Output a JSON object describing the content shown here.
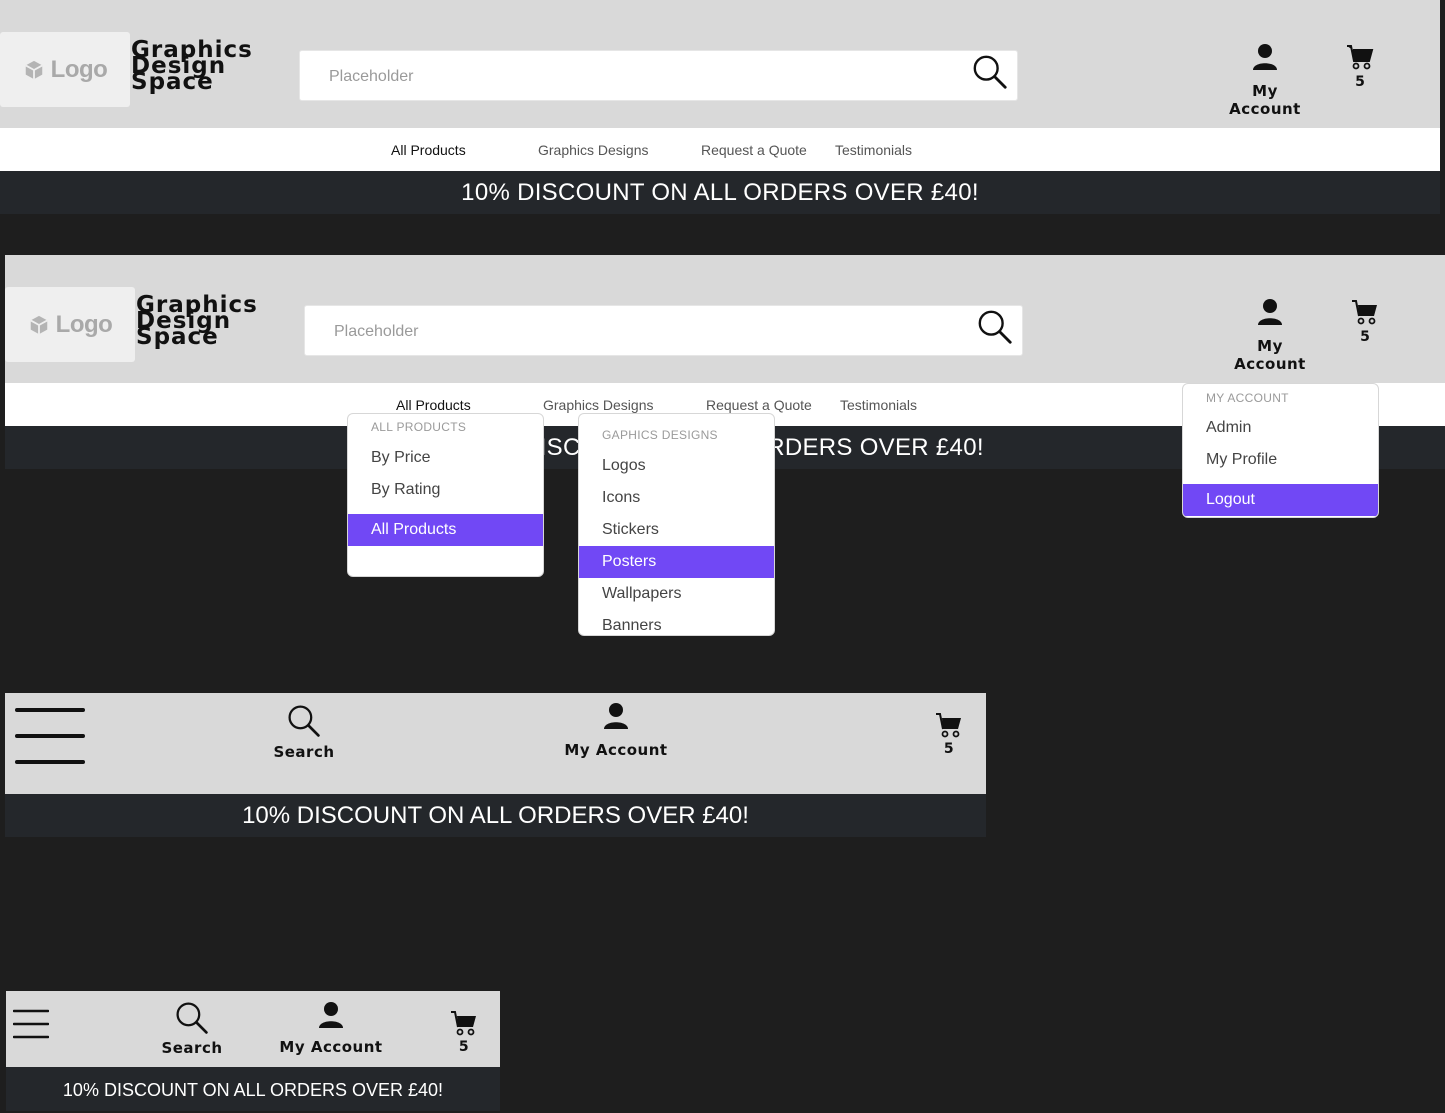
{
  "header": {
    "logo_text": "Logo",
    "brand_lines": [
      "Graphics",
      "Design",
      "Space"
    ],
    "search_placeholder": "Placeholder",
    "account_label": "My Account",
    "cart_count": "5"
  },
  "nav": {
    "items": [
      "All Products",
      "Graphics Designs",
      "Request a Quote",
      "Testimonials"
    ]
  },
  "banner_text": "10% DISCOUNT ON ALL ORDERS OVER £40!",
  "dropdowns": {
    "all_products": {
      "heading": "ALL PRODUCTS",
      "items": [
        "By Price",
        "By Rating",
        "All Products"
      ],
      "selected": "All Products"
    },
    "graphics_designs": {
      "heading": "GAPHICS DESIGNS",
      "items": [
        "Logos",
        "Icons",
        "Stickers",
        "Posters",
        "Wallpapers",
        "Banners"
      ],
      "selected": "Posters"
    },
    "my_account": {
      "heading": "MY ACCOUNT",
      "items": [
        "Admin",
        "My Profile",
        "Logout"
      ],
      "selected": "Logout"
    }
  },
  "mobile": {
    "search_label": "Search",
    "account_label": "My Account",
    "cart_count": "5"
  },
  "colors": {
    "accent": "#7148f5",
    "header_bg": "#d9d9d9",
    "banner_bg": "#24272b",
    "page_bg": "#1e1e1e"
  }
}
